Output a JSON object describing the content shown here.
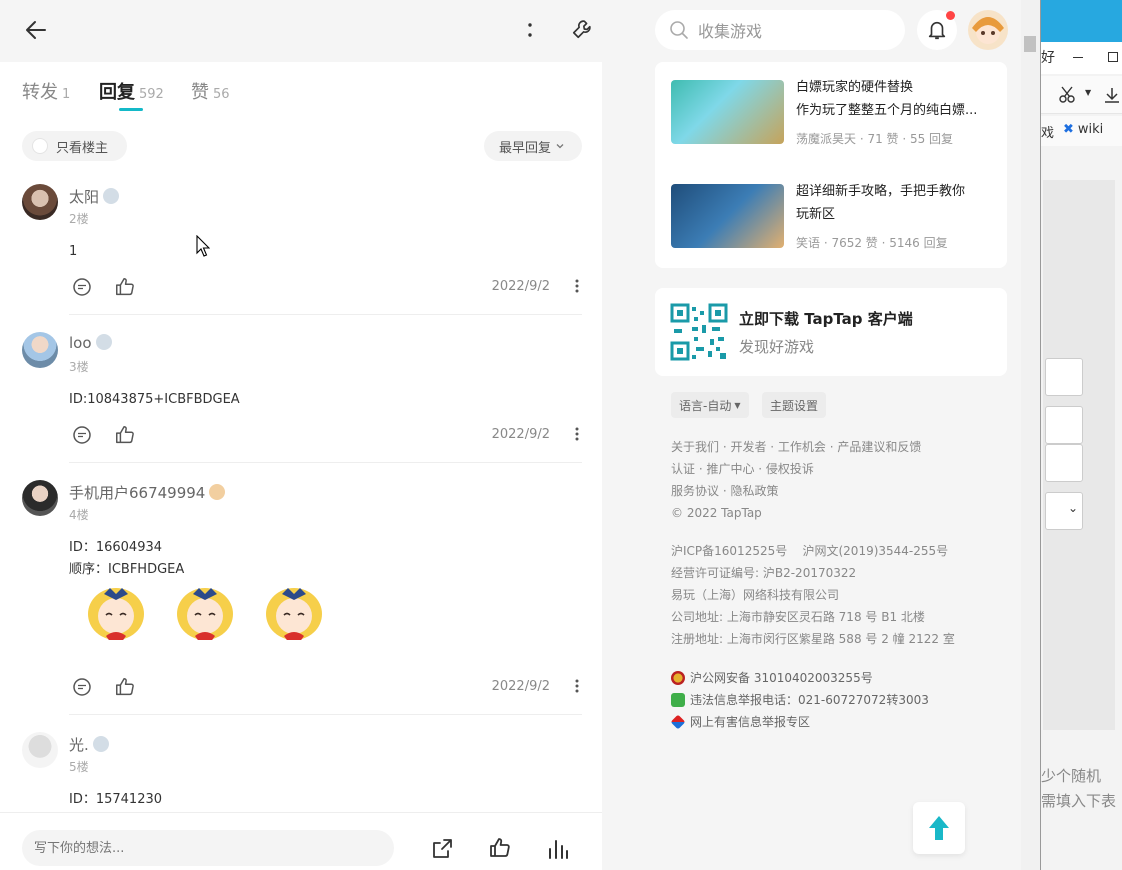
{
  "post_header": {
    "back_label": "back",
    "tabs": [
      {
        "label": "转发",
        "count": "1"
      },
      {
        "label": "回复",
        "count": "592"
      },
      {
        "label": "赞",
        "count": "56"
      }
    ],
    "active_tab": "回复",
    "only_op_label": "只看楼主",
    "sort_label": "最早回复"
  },
  "comments": [
    {
      "user": "太阳",
      "floor": "2楼",
      "lines": [
        "1"
      ],
      "date": "2022/9/2"
    },
    {
      "user": "loo",
      "floor": "3楼",
      "lines": [
        "ID:10843875+ICBFBDGEA"
      ],
      "date": "2022/9/2"
    },
    {
      "user": "手机用户66749994",
      "floor": "4楼",
      "lines": [
        "ID：16604934",
        "顺序：ICBFHDGEA"
      ],
      "date": "2022/9/2",
      "stickers": 3
    },
    {
      "user": "光.",
      "floor": "5楼",
      "lines": [
        "ID：15741230"
      ],
      "date": ""
    }
  ],
  "bottom_bar": {
    "reply_placeholder": "写下你的想法..."
  },
  "right": {
    "search_placeholder": "收集游戏",
    "recommended": [
      {
        "title_line1": "白嫖玩家的硬件替换",
        "title_line2": "作为玩了整整五个月的纯白嫖...",
        "meta": "荡魔派昊天 · 71 赞 · 55 回复"
      },
      {
        "title_line1": "超详细新手攻略，手把手教你",
        "title_line2": "玩新区",
        "meta": "笑语 · 7652 赞 · 5146 回复"
      }
    ],
    "download": {
      "title": "立即下载 TapTap 客户端",
      "subtitle": "发现好游戏"
    },
    "lang_button": "语言-自动",
    "theme_button": "主题设置",
    "footer_links": [
      "关于我们 · 开发者 · 工作机会 · 产品建议和反馈",
      "认证 · 推广中心 · 侵权投诉",
      "服务协议 · 隐私政策",
      "© 2022 TapTap"
    ],
    "legal": [
      "沪ICP备16012525号    沪网文(2019)3544-255号",
      "经营许可证编号: 沪B2-20170322",
      "易玩（上海）网络科技有限公司",
      "公司地址: 上海市静安区灵石路 718 号 B1 北楼",
      "注册地址: 上海市闵行区紫星路 588 号 2 幢 2122 室"
    ],
    "gov": [
      "沪公网安备 31010402003255号",
      "违法信息举报电话：021-60727072转3003",
      "网上有害信息举报专区"
    ]
  },
  "background_window": {
    "menu_fragment": "戏",
    "wiki_label": "wiki",
    "text_line1": "少个随机",
    "text_line2": "需填入下表",
    "glyph": "好"
  },
  "colors": {
    "accent": "#14b9c8",
    "notify": "#ff4444",
    "scroll_up": "#19b8c8"
  }
}
